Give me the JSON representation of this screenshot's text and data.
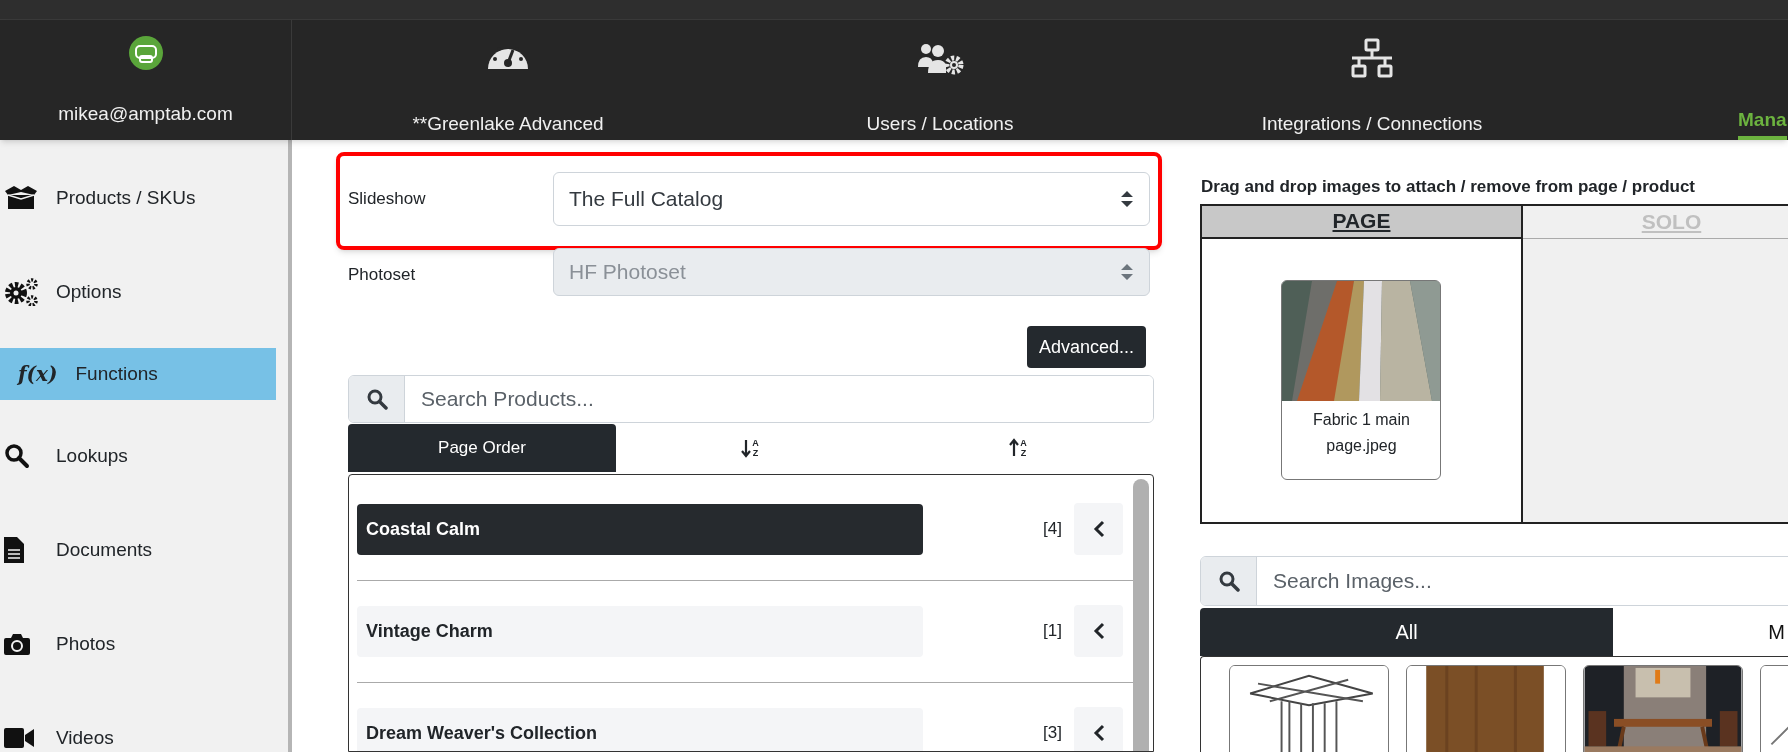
{
  "account": {
    "email": "mikea@amptab.com"
  },
  "nav": [
    {
      "label": "**Greenlake Advanced",
      "selected": false
    },
    {
      "label": "Users / Locations",
      "selected": false
    },
    {
      "label": "Integrations / Connections",
      "selected": false
    },
    {
      "label": "Mana",
      "selected": true
    }
  ],
  "sidebar": {
    "items": [
      {
        "label": "Products / SKUs",
        "selected": false
      },
      {
        "label": "Options",
        "selected": false
      },
      {
        "label": "Functions",
        "glyph": "f(x)",
        "selected": true
      },
      {
        "label": "Lookups",
        "selected": false
      },
      {
        "label": "Documents",
        "selected": false
      },
      {
        "label": "Photos",
        "selected": false
      },
      {
        "label": "Videos",
        "selected": false
      }
    ]
  },
  "slideshow": {
    "label": "Slideshow",
    "value": "The Full Catalog",
    "highlighted": true
  },
  "photoset": {
    "label": "Photoset",
    "value": "HF Photoset",
    "disabled": true
  },
  "advanced_button": "Advanced...",
  "product_search": {
    "placeholder": "Search Products..."
  },
  "sort_tabs": [
    {
      "kind": "text",
      "label": "Page Order",
      "selected": true
    },
    {
      "kind": "sort-down",
      "letters": [
        "A",
        "Z"
      ],
      "selected": false
    },
    {
      "kind": "sort-up",
      "letters": [
        "A",
        "Z"
      ],
      "selected": false
    }
  ],
  "products": [
    {
      "name": "Coastal Calm",
      "count": "[4]",
      "selected": true
    },
    {
      "name": "Vintage Charm",
      "count": "[1]",
      "selected": false
    },
    {
      "name": "Dream Weaver's Collection",
      "count": "[3]",
      "selected": false
    }
  ],
  "attach_panel": {
    "heading": "Drag and drop images to attach / remove from page / product",
    "tabs": [
      {
        "label": "PAGE",
        "selected": true
      },
      {
        "label": "SOLO",
        "selected": false
      }
    ],
    "page_images": [
      {
        "caption": "Fabric 1 main page.jpeg",
        "kind": "picture"
      }
    ]
  },
  "image_search": {
    "placeholder": "Search Images..."
  },
  "image_tabs": [
    {
      "label": "All",
      "selected": true
    },
    {
      "label": "M",
      "selected": false
    }
  ]
}
